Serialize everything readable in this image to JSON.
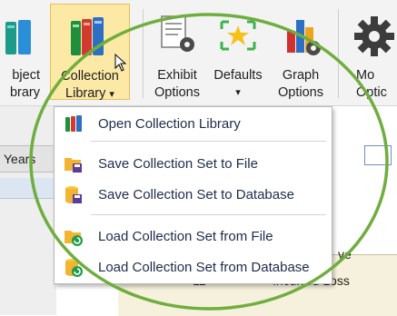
{
  "ribbon": {
    "buttons": [
      {
        "label": "bject\nbrary",
        "icon": "object-library-icon"
      },
      {
        "label": "Collection\nLibrary",
        "icon": "collection-library-icon",
        "active": true
      },
      {
        "label": "Exhibit\nOptions",
        "icon": "exhibit-options-icon"
      },
      {
        "label": "Defaults",
        "icon": "defaults-icon"
      },
      {
        "label": "Graph\nOptions",
        "icon": "graph-options-icon"
      },
      {
        "label": "Mo\nOptic",
        "icon": "model-options-icon"
      }
    ],
    "collection_label_line1": "Collection",
    "collection_label_line2": "Library",
    "object_line1": "bject",
    "object_line2": "brary",
    "exhibit_line1": "Exhibit",
    "exhibit_line2": "Options",
    "defaults_line1": "Defaults",
    "defaults_arrow": "▾",
    "graph_line1": "Graph",
    "graph_line2": "Options",
    "model_line1": "Mo",
    "model_line2": "Optic"
  },
  "background": {
    "side_tab": "Years",
    "grid_row_number": "11",
    "grid_row_text": "Incurred Loss",
    "right_partial": "ve"
  },
  "menu": {
    "items": [
      {
        "label": "Open Collection Library",
        "icon": "book-icon"
      },
      {
        "label": "Save Collection Set to File",
        "icon": "save-file-icon"
      },
      {
        "label": "Save Collection Set to Database",
        "icon": "save-database-icon"
      },
      {
        "label": "Load Collection Set from File",
        "icon": "load-file-icon"
      },
      {
        "label": "Load Collection Set from Database",
        "icon": "load-database-icon"
      }
    ]
  },
  "colors": {
    "active_button_fill": "#fce9a6",
    "annotation": "#6fae3e",
    "menu_text": "#1f2b4b"
  }
}
